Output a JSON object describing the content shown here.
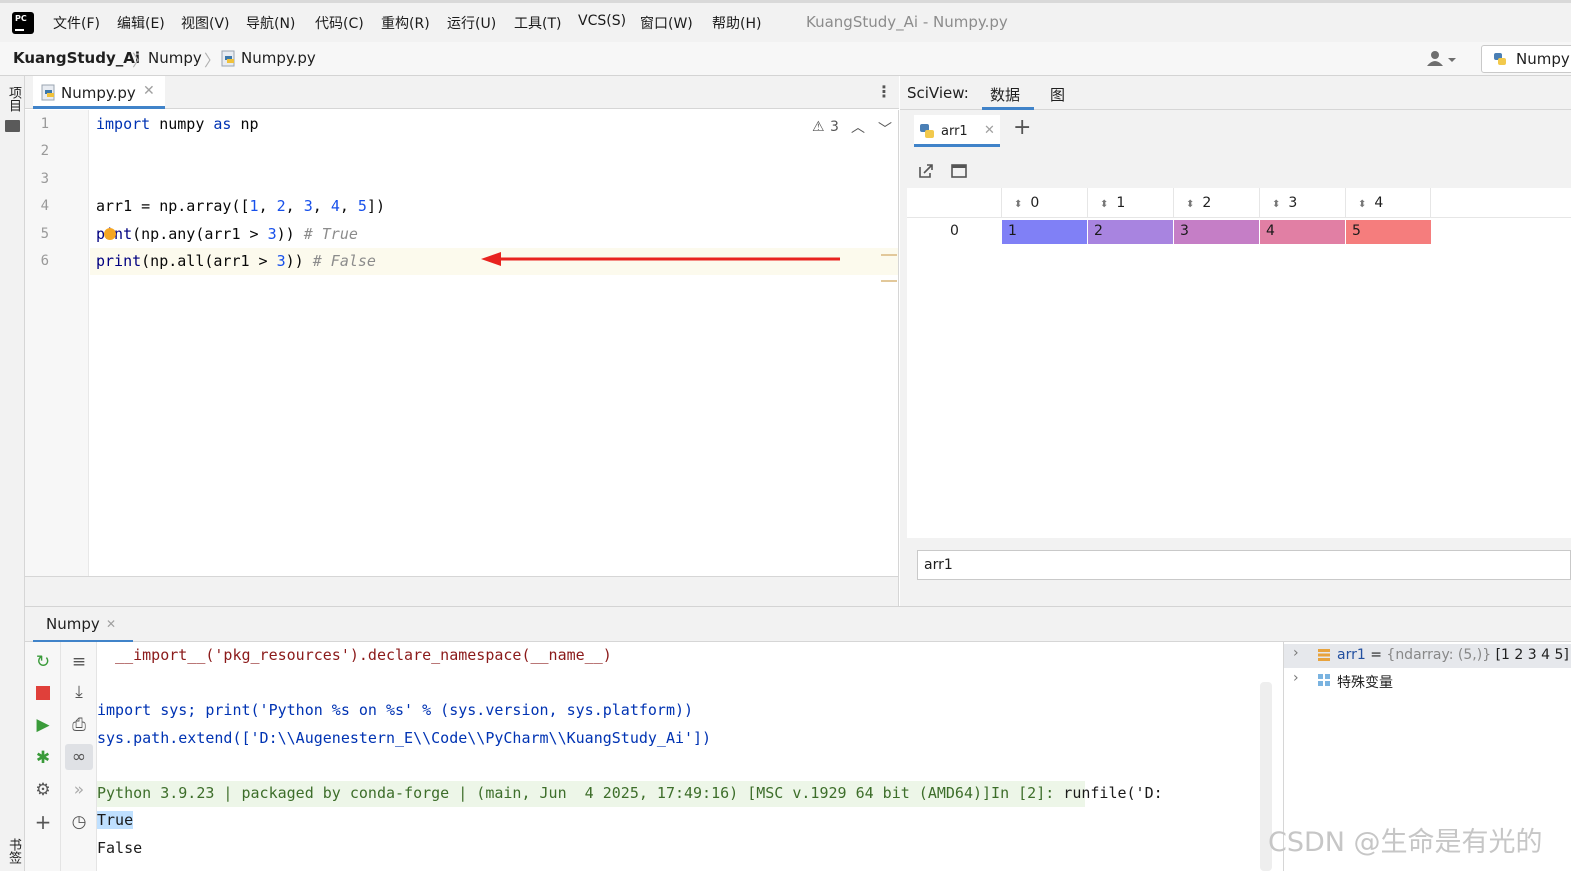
{
  "menubar": {
    "items": [
      "文件(F)",
      "编辑(E)",
      "视图(V)",
      "导航(N)",
      "代码(C)",
      "重构(R)",
      "运行(U)",
      "工具(T)",
      "VCS(S)",
      "窗口(W)",
      "帮助(H)"
    ],
    "window_title": "KuangStudy_Ai - Numpy.py",
    "logo_text": "PC"
  },
  "breadcrumb": {
    "project": "KuangStudy_Ai",
    "folder": "Numpy",
    "file": "Numpy.py",
    "run_config": "Numpy"
  },
  "left_strip": {
    "project_label": "项目",
    "bookmarks_label": "书签"
  },
  "editor": {
    "tab_label": "Numpy.py",
    "warnings_count": "3",
    "line_numbers": [
      "1",
      "2",
      "3",
      "4",
      "5",
      "6"
    ],
    "code": {
      "l1_kw1": "import",
      "l1_mod": " numpy ",
      "l1_kw2": "as",
      "l1_alias": " np",
      "l4_a": "arr1 = np.array([",
      "l4_n1": "1",
      "l4_c1": ", ",
      "l4_n2": "2",
      "l4_c2": ", ",
      "l4_n3": "3",
      "l4_c3": ", ",
      "l4_n4": "4",
      "l4_c4": ", ",
      "l4_n5": "5",
      "l4_end": "])",
      "l5_fn_a": "p",
      "l5_fn_b": "int",
      "l5_mid": "(np.any(arr1 > ",
      "l5_num": "3",
      "l5_end": "))",
      "l5_comment": " # True",
      "l6_fn": "print",
      "l6_mid": "(np.all(arr1 > ",
      "l6_num": "3",
      "l6_end": "))",
      "l6_comment": " # False"
    },
    "arrow_color": "#e8231f"
  },
  "sciview": {
    "title": "SciView:",
    "tab_data": "数据",
    "tab_plot": "图",
    "var_tab": "arr1",
    "add_tab": "+",
    "columns": [
      "0",
      "1",
      "2",
      "3",
      "4"
    ],
    "row_index": "0",
    "cells": [
      "1",
      "2",
      "3",
      "4",
      "5"
    ],
    "cell_colors": [
      "#8080f6",
      "#a884e0",
      "#c57ec6",
      "#e17fa4",
      "#f57d7d"
    ],
    "input_value": "arr1"
  },
  "console": {
    "tab_label": "Numpy",
    "lines": [
      "  __import__('pkg_resources').declare_namespace(__name__)",
      "import sys; print('Python %s on %s' % (sys.version, sys.platform))",
      "sys.path.extend(['D:\\\\Augenestern_E\\\\Code\\\\PyCharm\\\\KuangStudy_Ai'])",
      "Python 3.9.23 | packaged by conda-forge | (main, Jun  4 2025, 17:49:16) [MSC v.1929 64 bit (AMD64)]",
      "In [2]: ",
      "runfile('D:",
      "True",
      "False"
    ]
  },
  "variables": {
    "arr1_name": "arr1",
    "arr1_eq": " = ",
    "arr1_type": "{ndarray: (5,)}",
    "arr1_value": " [1 2 3 4 5] ..",
    "special_vars": "特殊变量"
  },
  "watermark": "CSDN @生命是有光的"
}
